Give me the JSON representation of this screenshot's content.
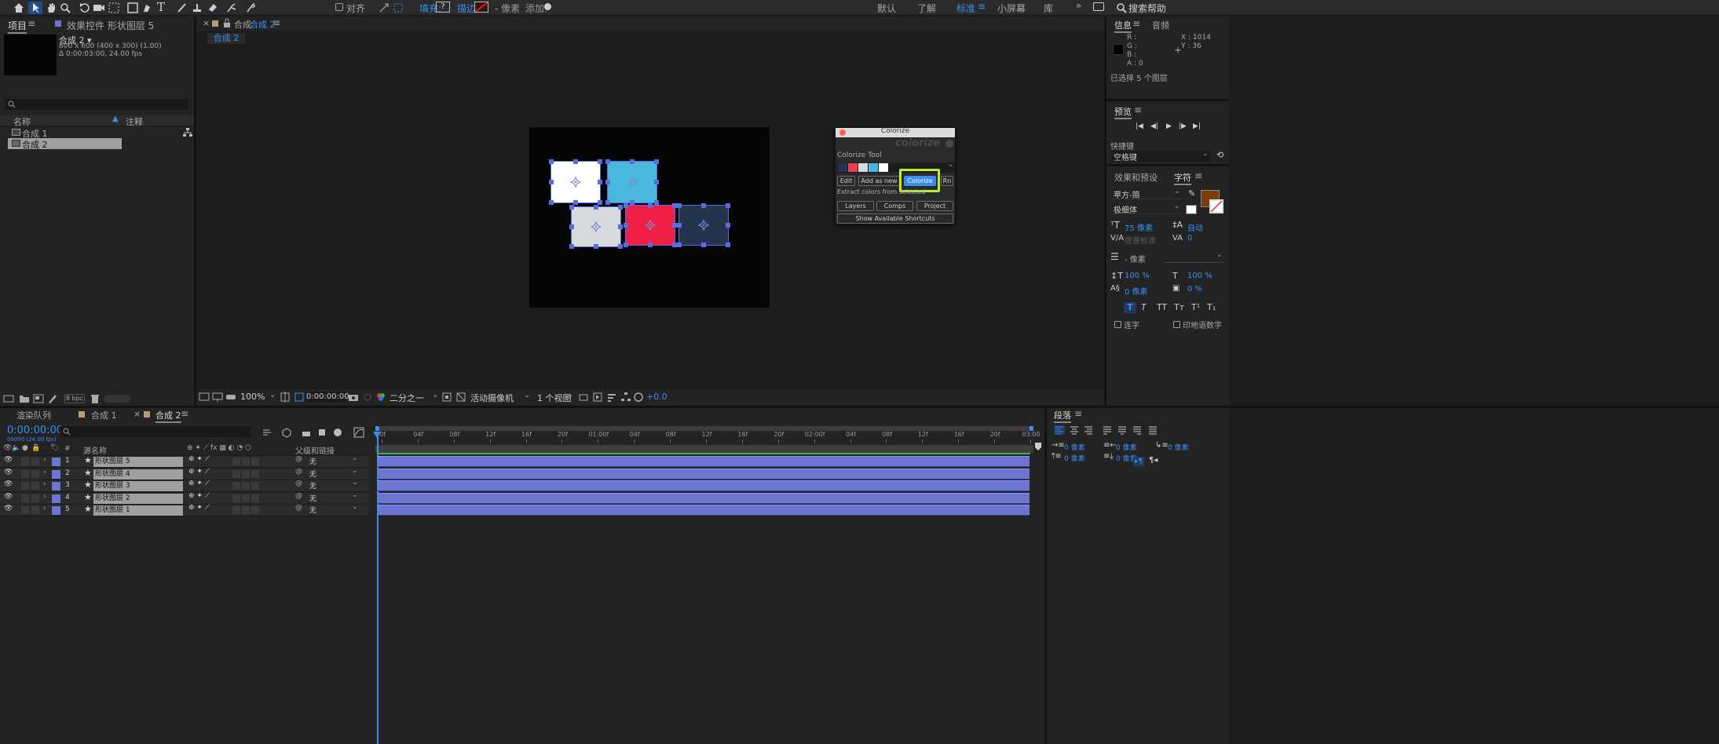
{
  "toolbar": {
    "align_label": "对齐",
    "fill_label": "填充:",
    "stroke_label": "描边:",
    "stroke_px": "- 像素",
    "add_label": "添加:",
    "workspaces": [
      "默认",
      "了解",
      "标准",
      "小屏幕",
      "库"
    ],
    "search_placeholder": "搜索帮助"
  },
  "project_panel": {
    "tab_project": "项目",
    "tab_effects": "效果控件 形状图层 5",
    "comp_name": "合成 2 ▾",
    "comp_size": "800 x 600  (400 x 300) (1.00)",
    "comp_duration": "Δ 0:00:03:00, 24.00 fps",
    "col_name": "名称",
    "col_comment": "注释",
    "items": [
      "合成 1",
      "合成 2"
    ],
    "bpc": "8 bpc"
  },
  "comp_viewer": {
    "tab_label": "合成",
    "tab_name": "合成 2",
    "breadcrumb": "合成 2",
    "zoom": "100%",
    "timecode": "0:00:00:00",
    "resolution": "二分之一",
    "camera": "活动摄像机",
    "views": "1 个视图",
    "exposure": "+0.0"
  },
  "canvas_shapes": [
    {
      "name": "shape-white",
      "color": "#ffffff"
    },
    {
      "name": "shape-sky-blue",
      "color": "#4ab8de"
    },
    {
      "name": "shape-light-gray",
      "color": "#d7dbde"
    },
    {
      "name": "shape-red",
      "color": "#ef1f45"
    },
    {
      "name": "shape-navy",
      "color": "#22344e"
    }
  ],
  "colorize": {
    "window_title": "Colorize",
    "logo": "colorize",
    "tool_label": "Colorize Tool",
    "swatches": [
      "#22344e",
      "#ef4050",
      "#d7dbde",
      "#4ab8de",
      "#ffffff"
    ],
    "btn_edit": "Edit",
    "btn_add_new": "Add as new",
    "btn_colorize": "Colorize",
    "btn_rn": "Rn",
    "extract_text": "Extract colors from selected",
    "btn_layers": "Layers",
    "btn_comps": "Comps",
    "btn_project": "Project",
    "btn_shortcuts": "Show Available Shortcuts"
  },
  "info_panel": {
    "tab_info": "信息",
    "tab_audio": "音频",
    "r": "R :",
    "g": "G :",
    "b": "B :",
    "a": "A :  0",
    "x": "X : 1014",
    "y": "Y : 36",
    "selection": "已选择 5 个图层"
  },
  "preview_panel": {
    "title": "预览",
    "shortcut_label": "快捷键",
    "shortcut_value": "空格键"
  },
  "character_panel": {
    "tab_effects": "效果和预设",
    "tab_character": "字符",
    "font": "苹方-简",
    "style": "极细体",
    "font_size": "75 像素",
    "leading": "自动",
    "kerning": "度量标准",
    "tracking": "0",
    "stroke": "- 像素",
    "vscale": "100 %",
    "hscale": "100 %",
    "baseline": "0 像素",
    "tsume": "0 %",
    "ligatures": "连字",
    "hindi": "印地语数字",
    "fill_color": "#7a3d0a"
  },
  "paragraph_panel": {
    "title": "段落",
    "val1": "0 像素",
    "val2": "0 像素",
    "val3": "0 像素",
    "val4": "0 像素",
    "val5": "0 像素"
  },
  "timeline": {
    "tab_render": "渲染队列",
    "tab_comp1": "合成 1",
    "tab_comp2": "合成 2",
    "timecode": "0:00:00:00",
    "fps_sub": "00000 (24.00 fps)",
    "col_num": "#",
    "col_source": "源名称",
    "col_parent": "父级和链接",
    "ruler": [
      "0f",
      "04f",
      "08f",
      "12f",
      "16f",
      "20f",
      "01:00f",
      "04f",
      "08f",
      "12f",
      "16f",
      "20f",
      "02:00f",
      "04f",
      "08f",
      "12f",
      "16f",
      "20f",
      "03:00"
    ],
    "layers": [
      {
        "num": "1",
        "name": "形状图层 5",
        "parent": "无"
      },
      {
        "num": "2",
        "name": "形状图层 4",
        "parent": "无"
      },
      {
        "num": "3",
        "name": "形状图层 3",
        "parent": "无"
      },
      {
        "num": "4",
        "name": "形状图层 2",
        "parent": "无"
      },
      {
        "num": "5",
        "name": "形状图层 1",
        "parent": "无"
      }
    ]
  }
}
